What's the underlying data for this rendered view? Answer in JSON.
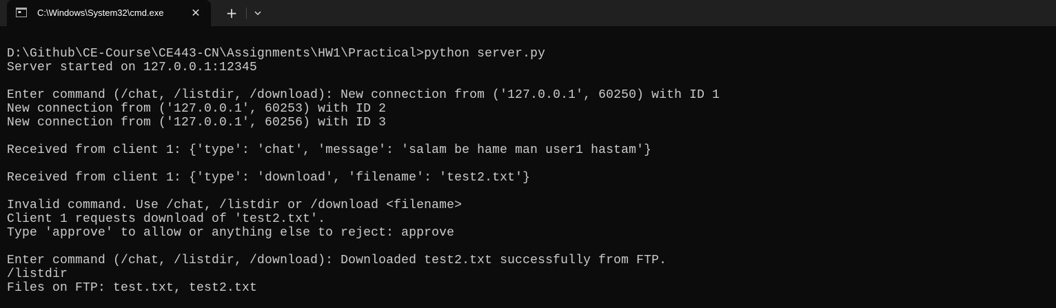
{
  "tab": {
    "title": "C:\\Windows\\System32\\cmd.exe",
    "close_glyph": "✕",
    "new_tab_glyph": "+",
    "icon": "cmd-icon"
  },
  "terminal": {
    "lines": [
      "D:\\Github\\CE-Course\\CE443-CN\\Assignments\\HW1\\Practical>python server.py",
      "Server started on 127.0.0.1:12345",
      "",
      "Enter command (/chat, /listdir, /download): New connection from ('127.0.0.1', 60250) with ID 1",
      "New connection from ('127.0.0.1', 60253) with ID 2",
      "New connection from ('127.0.0.1', 60256) with ID 3",
      "",
      "Received from client 1: {'type': 'chat', 'message': 'salam be hame man user1 hastam'}",
      "",
      "Received from client 1: {'type': 'download', 'filename': 'test2.txt'}",
      "",
      "Invalid command. Use /chat, /listdir or /download <filename>",
      "Client 1 requests download of 'test2.txt'.",
      "Type 'approve' to allow or anything else to reject: approve",
      "",
      "Enter command (/chat, /listdir, /download): Downloaded test2.txt successfully from FTP.",
      "/listdir",
      "Files on FTP: test.txt, test2.txt"
    ]
  },
  "colors": {
    "background": "#0c0c0c",
    "titlebar": "#202020",
    "text": "#cccccc"
  }
}
